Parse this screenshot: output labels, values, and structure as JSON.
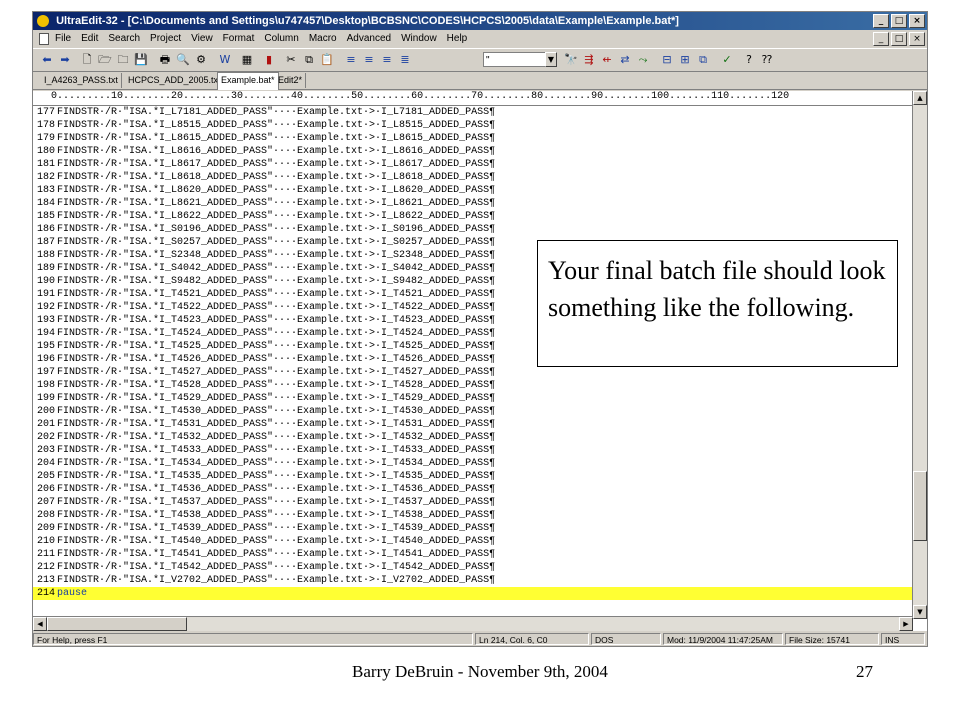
{
  "window": {
    "title": "UltraEdit-32 - [C:\\Documents and Settings\\u747457\\Desktop\\BCBSNC\\CODES\\HCPCS\\2005\\data\\Example\\Example.bat*]",
    "min_glyph": "_",
    "max_glyph": "□",
    "close_glyph": "×"
  },
  "menu": [
    "File",
    "Edit",
    "Search",
    "Project",
    "View",
    "Format",
    "Column",
    "Macro",
    "Advanced",
    "Window",
    "Help"
  ],
  "toolbar": {
    "font_combo_value": "\""
  },
  "tabs": [
    "I_A4263_PASS.txt",
    "HCPCS_ADD_2005.txt",
    "Example.bat*",
    "Edit2*"
  ],
  "active_tab_index": 2,
  "ruler": "0.........10........20........30........40........50........60........70........80........90........100.......110.......120",
  "lines": [
    {
      "n": "177",
      "text": "FINDSTR·/R·\"ISA.*I_L7181_ADDED_PASS\"····Example.txt·>·I_L7181_ADDED_PASS¶"
    },
    {
      "n": "178",
      "text": "FINDSTR·/R·\"ISA.*I_L8515_ADDED_PASS\"····Example.txt·>·I_L8515_ADDED_PASS¶"
    },
    {
      "n": "179",
      "text": "FINDSTR·/R·\"ISA.*I_L8615_ADDED_PASS\"····Example.txt·>·I_L8615_ADDED_PASS¶"
    },
    {
      "n": "180",
      "text": "FINDSTR·/R·\"ISA.*I_L8616_ADDED_PASS\"····Example.txt·>·I_L8616_ADDED_PASS¶"
    },
    {
      "n": "181",
      "text": "FINDSTR·/R·\"ISA.*I_L8617_ADDED_PASS\"····Example.txt·>·I_L8617_ADDED_PASS¶"
    },
    {
      "n": "182",
      "text": "FINDSTR·/R·\"ISA.*I_L8618_ADDED_PASS\"····Example.txt·>·I_L8618_ADDED_PASS¶"
    },
    {
      "n": "183",
      "text": "FINDSTR·/R·\"ISA.*I_L8620_ADDED_PASS\"····Example.txt·>·I_L8620_ADDED_PASS¶"
    },
    {
      "n": "184",
      "text": "FINDSTR·/R·\"ISA.*I_L8621_ADDED_PASS\"····Example.txt·>·I_L8621_ADDED_PASS¶"
    },
    {
      "n": "185",
      "text": "FINDSTR·/R·\"ISA.*I_L8622_ADDED_PASS\"····Example.txt·>·I_L8622_ADDED_PASS¶"
    },
    {
      "n": "186",
      "text": "FINDSTR·/R·\"ISA.*I_S0196_ADDED_PASS\"····Example.txt·>·I_S0196_ADDED_PASS¶"
    },
    {
      "n": "187",
      "text": "FINDSTR·/R·\"ISA.*I_S0257_ADDED_PASS\"····Example.txt·>·I_S0257_ADDED_PASS¶"
    },
    {
      "n": "188",
      "text": "FINDSTR·/R·\"ISA.*I_S2348_ADDED_PASS\"····Example.txt·>·I_S2348_ADDED_PASS¶"
    },
    {
      "n": "189",
      "text": "FINDSTR·/R·\"ISA.*I_S4042_ADDED_PASS\"····Example.txt·>·I_S4042_ADDED_PASS¶"
    },
    {
      "n": "190",
      "text": "FINDSTR·/R·\"ISA.*I_S9482_ADDED_PASS\"····Example.txt·>·I_S9482_ADDED_PASS¶"
    },
    {
      "n": "191",
      "text": "FINDSTR·/R·\"ISA.*I_T4521_ADDED_PASS\"····Example.txt·>·I_T4521_ADDED_PASS¶"
    },
    {
      "n": "192",
      "text": "FINDSTR·/R·\"ISA.*I_T4522_ADDED_PASS\"····Example.txt·>·I_T4522_ADDED_PASS¶"
    },
    {
      "n": "193",
      "text": "FINDSTR·/R·\"ISA.*I_T4523_ADDED_PASS\"····Example.txt·>·I_T4523_ADDED_PASS¶"
    },
    {
      "n": "194",
      "text": "FINDSTR·/R·\"ISA.*I_T4524_ADDED_PASS\"····Example.txt·>·I_T4524_ADDED_PASS¶"
    },
    {
      "n": "195",
      "text": "FINDSTR·/R·\"ISA.*I_T4525_ADDED_PASS\"····Example.txt·>·I_T4525_ADDED_PASS¶"
    },
    {
      "n": "196",
      "text": "FINDSTR·/R·\"ISA.*I_T4526_ADDED_PASS\"····Example.txt·>·I_T4526_ADDED_PASS¶"
    },
    {
      "n": "197",
      "text": "FINDSTR·/R·\"ISA.*I_T4527_ADDED_PASS\"····Example.txt·>·I_T4527_ADDED_PASS¶"
    },
    {
      "n": "198",
      "text": "FINDSTR·/R·\"ISA.*I_T4528_ADDED_PASS\"····Example.txt·>·I_T4528_ADDED_PASS¶"
    },
    {
      "n": "199",
      "text": "FINDSTR·/R·\"ISA.*I_T4529_ADDED_PASS\"····Example.txt·>·I_T4529_ADDED_PASS¶"
    },
    {
      "n": "200",
      "text": "FINDSTR·/R·\"ISA.*I_T4530_ADDED_PASS\"····Example.txt·>·I_T4530_ADDED_PASS¶"
    },
    {
      "n": "201",
      "text": "FINDSTR·/R·\"ISA.*I_T4531_ADDED_PASS\"····Example.txt·>·I_T4531_ADDED_PASS¶"
    },
    {
      "n": "202",
      "text": "FINDSTR·/R·\"ISA.*I_T4532_ADDED_PASS\"····Example.txt·>·I_T4532_ADDED_PASS¶"
    },
    {
      "n": "203",
      "text": "FINDSTR·/R·\"ISA.*I_T4533_ADDED_PASS\"····Example.txt·>·I_T4533_ADDED_PASS¶"
    },
    {
      "n": "204",
      "text": "FINDSTR·/R·\"ISA.*I_T4534_ADDED_PASS\"····Example.txt·>·I_T4534_ADDED_PASS¶"
    },
    {
      "n": "205",
      "text": "FINDSTR·/R·\"ISA.*I_T4535_ADDED_PASS\"····Example.txt·>·I_T4535_ADDED_PASS¶"
    },
    {
      "n": "206",
      "text": "FINDSTR·/R·\"ISA.*I_T4536_ADDED_PASS\"····Example.txt·>·I_T4536_ADDED_PASS¶"
    },
    {
      "n": "207",
      "text": "FINDSTR·/R·\"ISA.*I_T4537_ADDED_PASS\"····Example.txt·>·I_T4537_ADDED_PASS¶"
    },
    {
      "n": "208",
      "text": "FINDSTR·/R·\"ISA.*I_T4538_ADDED_PASS\"····Example.txt·>·I_T4538_ADDED_PASS¶"
    },
    {
      "n": "209",
      "text": "FINDSTR·/R·\"ISA.*I_T4539_ADDED_PASS\"····Example.txt·>·I_T4539_ADDED_PASS¶"
    },
    {
      "n": "210",
      "text": "FINDSTR·/R·\"ISA.*I_T4540_ADDED_PASS\"····Example.txt·>·I_T4540_ADDED_PASS¶"
    },
    {
      "n": "211",
      "text": "FINDSTR·/R·\"ISA.*I_T4541_ADDED_PASS\"····Example.txt·>·I_T4541_ADDED_PASS¶"
    },
    {
      "n": "212",
      "text": "FINDSTR·/R·\"ISA.*I_T4542_ADDED_PASS\"····Example.txt·>·I_T4542_ADDED_PASS¶"
    },
    {
      "n": "213",
      "text": "FINDSTR·/R·\"ISA.*I_V2702_ADDED_PASS\"····Example.txt·>·I_V2702_ADDED_PASS¶"
    },
    {
      "n": "214",
      "text": "pause",
      "current": true
    }
  ],
  "status": {
    "help": "For Help, press F1",
    "position": "Ln 214, Col. 6, C0",
    "line_ending": "DOS",
    "modified": "Mod: 11/9/2004 11:47:25AM",
    "file_size": "File Size: 15741",
    "mode": "INS"
  },
  "callout": "Your final batch file should look something like the following.",
  "footer": {
    "credit": "Barry DeBruin - November 9th, 2004",
    "page_number": "27"
  },
  "colors": {
    "titlebar": "#0a246a",
    "current_line": "#ffff33",
    "chrome": "#d4d0c8"
  }
}
